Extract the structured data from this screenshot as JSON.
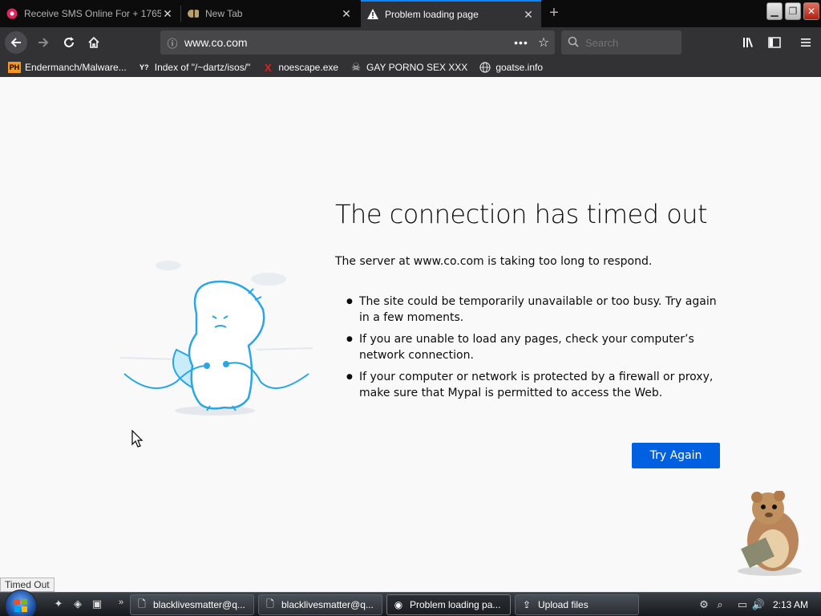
{
  "tabs": [
    {
      "title": "Receive SMS Online For + 1765",
      "favicon": "sms-icon",
      "active": false
    },
    {
      "title": "New Tab",
      "favicon": "moth-icon",
      "active": false
    },
    {
      "title": "Problem loading page",
      "favicon": "warning-icon",
      "active": true
    }
  ],
  "navbar": {
    "url": "www.co.com",
    "search_placeholder": "Search"
  },
  "bookmarks": [
    {
      "label": "Endermanch/Malware...",
      "icon": "ph-icon",
      "icon_text": "PH",
      "icon_color": "#f7971d"
    },
    {
      "label": "Index of \"/~dartz/isos/\"",
      "icon": "yp-icon",
      "icon_text": "Y?",
      "icon_color": "#ffffff"
    },
    {
      "label": "noescape.exe",
      "icon": "x-icon",
      "icon_text": "X",
      "icon_color": "#e22222"
    },
    {
      "label": "GAY PORNO SEX XXX",
      "icon": "pirate-icon",
      "icon_text": "☠",
      "icon_color": "#dddddd"
    },
    {
      "label": "goatse.info",
      "icon": "globe-icon",
      "icon_text": "🌐",
      "icon_color": "#dddddd"
    }
  ],
  "error": {
    "title": "The connection has timed out",
    "description": "The server at www.co.com is taking too long to respond.",
    "reasons": [
      "The site could be temporarily unavailable or too busy. Try again in a few moments.",
      "If you are unable to load any pages, check your computer’s network connection.",
      "If your computer or network is protected by a firewall or proxy, make sure that Mypal is permitted to access the Web."
    ],
    "button_label": "Try Again"
  },
  "status": "Timed Out",
  "taskbar": {
    "tasks": [
      {
        "label": "blacklivesmatter@q...",
        "icon": "ie-icon"
      },
      {
        "label": "blacklivesmatter@q...",
        "icon": "ie-icon"
      },
      {
        "label": "Problem loading pa...",
        "icon": "browser-icon"
      },
      {
        "label": "Upload files",
        "icon": "upload-icon"
      }
    ],
    "clock": "2:13 AM"
  },
  "colors": {
    "accent": "#0a84ff",
    "button": "#0060df",
    "dino": "#2aa7e0"
  }
}
